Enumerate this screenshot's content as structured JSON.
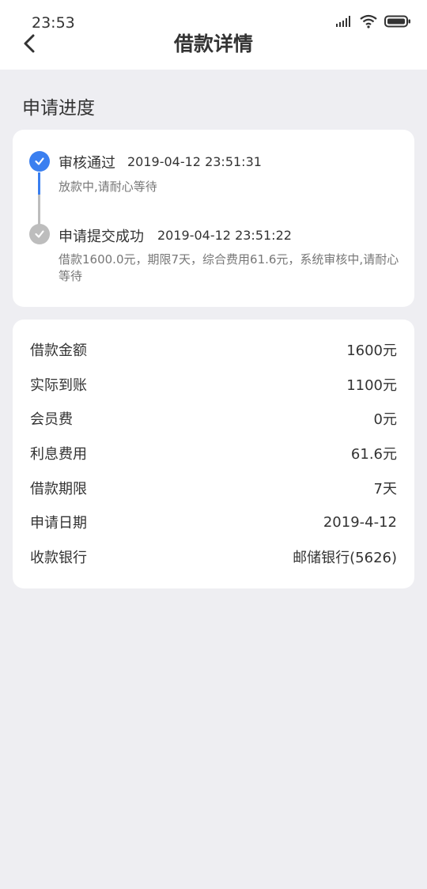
{
  "status_bar": {
    "time": "23:53"
  },
  "header": {
    "title": "借款详情"
  },
  "section": {
    "title": "申请进度"
  },
  "progress": [
    {
      "title": "审核通过",
      "time": "2019-04-12 23:51:31",
      "desc": "放款中,请耐心等待",
      "state": "active"
    },
    {
      "title": "申请提交成功",
      "time": "2019-04-12 23:51:22",
      "desc": "借款1600.0元，期限7天，综合费用61.6元，系统审核中,请耐心等待",
      "state": "done"
    }
  ],
  "details": [
    {
      "label": "借款金额",
      "value": "1600元"
    },
    {
      "label": "实际到账",
      "value": "1100元"
    },
    {
      "label": "会员费",
      "value": "0元"
    },
    {
      "label": "利息费用",
      "value": "61.6元"
    },
    {
      "label": "借款期限",
      "value": "7天"
    },
    {
      "label": "申请日期",
      "value": "2019-4-12"
    },
    {
      "label": "收款银行",
      "value": "邮储银行(5626)"
    }
  ],
  "colors": {
    "accent": "#3a7ff0",
    "inactive": "#bdbdbd",
    "background": "#eeeef2"
  },
  "icons": [
    "back-icon",
    "signal-icon",
    "wifi-icon",
    "battery-icon",
    "check-icon"
  ]
}
